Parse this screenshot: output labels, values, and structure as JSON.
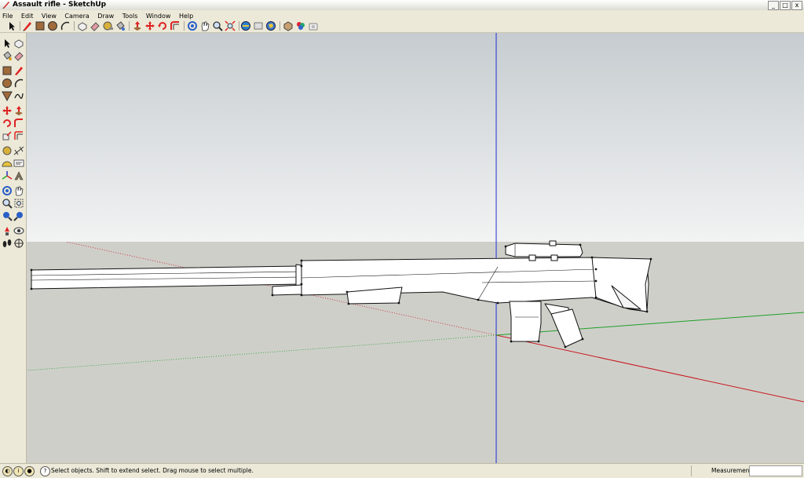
{
  "window": {
    "title": "Assault rifle - SketchUp",
    "buttons": [
      "_",
      "□",
      "x"
    ]
  },
  "menu": [
    "File",
    "Edit",
    "View",
    "Camera",
    "Draw",
    "Tools",
    "Window",
    "Help"
  ],
  "toolbar_icons": [
    "select-icon",
    "pencil-icon",
    "rectangle-icon",
    "circle-icon",
    "arc-icon",
    "make-component-icon",
    "eraser-icon",
    "tape-measure-icon",
    "paint-bucket-icon",
    "push-pull-icon",
    "move-icon",
    "rotate-icon",
    "follow-me-icon",
    "orbit-icon",
    "pan-icon",
    "zoom-icon",
    "zoom-extents-icon",
    "get-models-icon",
    "share-model-icon",
    "google-earth-icon",
    "component-icon",
    "paint-icon",
    "snapshot-icon"
  ],
  "status": {
    "message": "Select objects. Shift to extend select. Drag mouse to select multiple.",
    "measurements_label": "Measurements",
    "measurements_value": ""
  },
  "colors": {
    "sky_top": "#c8ced0",
    "sky_bottom": "#eef0f0",
    "ground": "#cfcfca",
    "axis_blue": "#1e2dd2",
    "axis_red": "#c8191e",
    "axis_green": "#1ea028"
  }
}
